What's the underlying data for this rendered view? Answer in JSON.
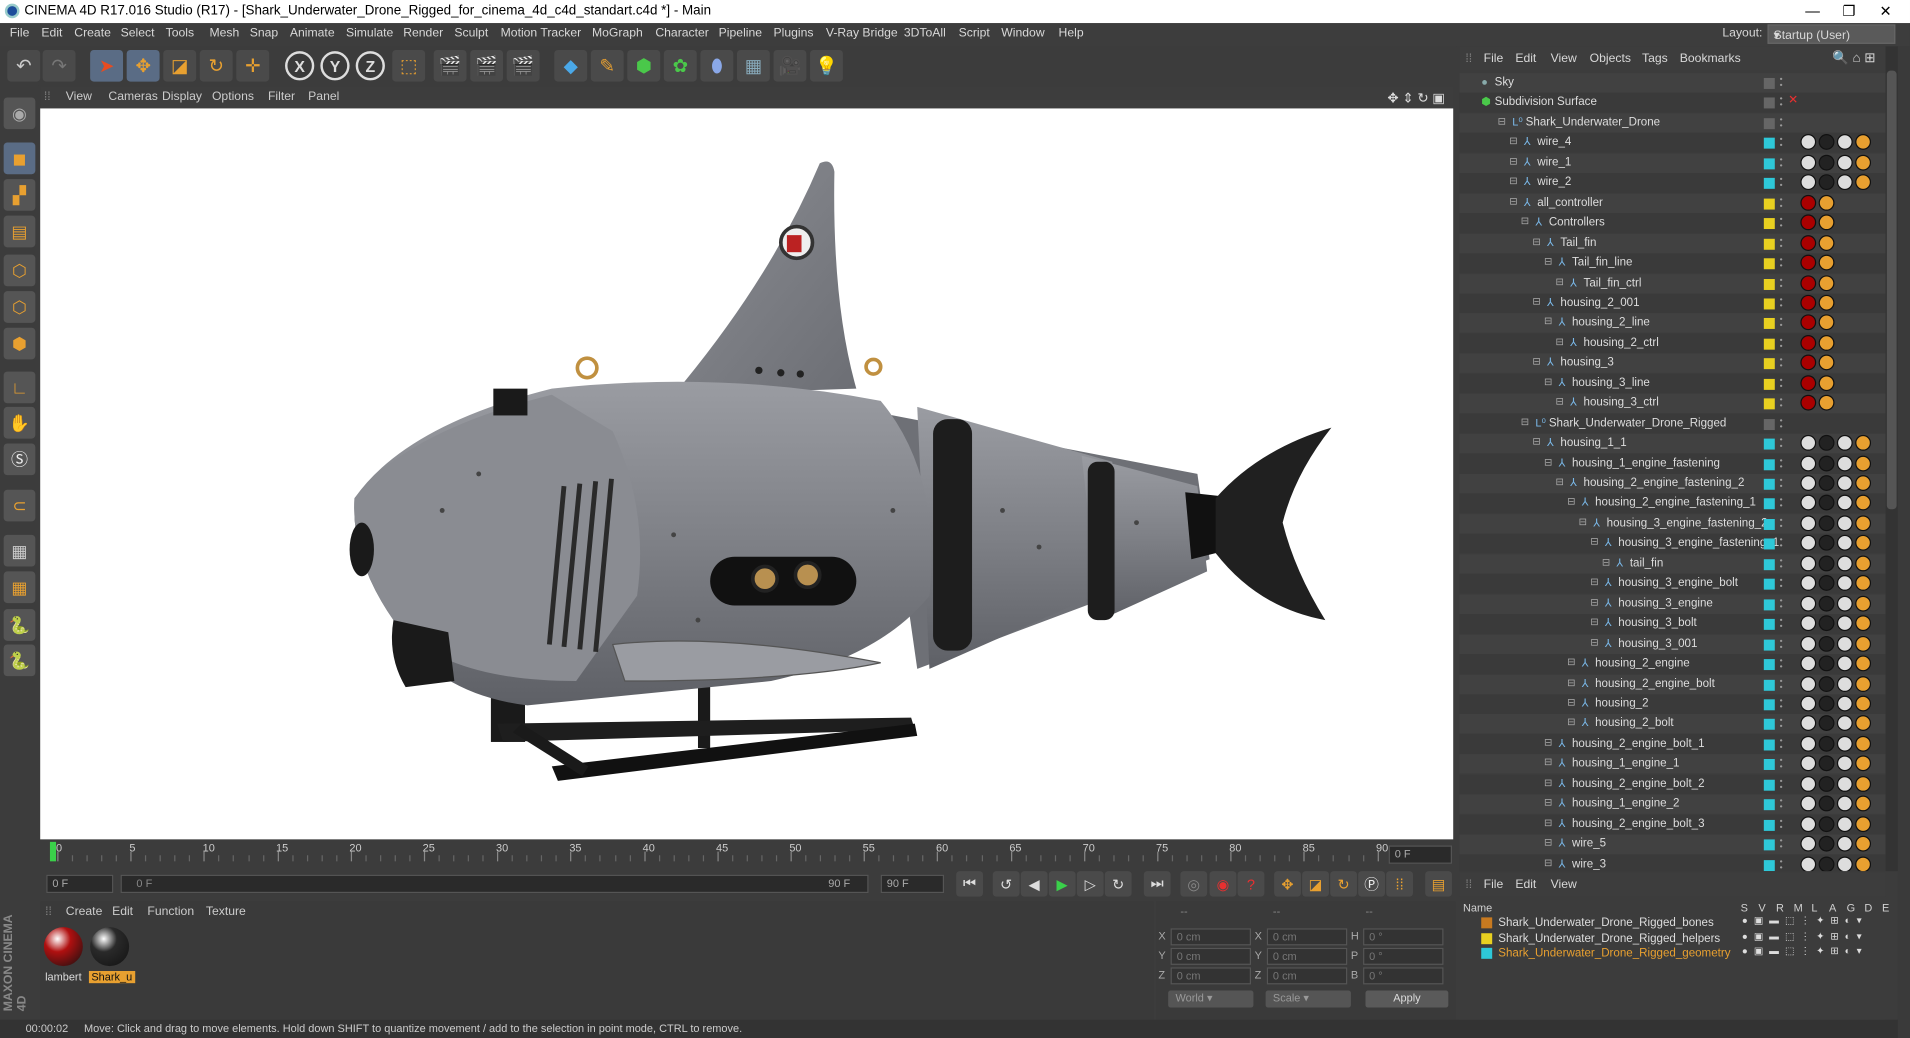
{
  "window": {
    "title": "CINEMA 4D R17.016 Studio (R17) - [Shark_Underwater_Drone_Rigged_for_cinema_4d_c4d_standart.c4d *] - Main",
    "controls": [
      "—",
      "❐",
      "✕"
    ]
  },
  "menubar": {
    "items": [
      "File",
      "Edit",
      "Create",
      "Select",
      "Tools",
      "Mesh",
      "Snap",
      "Animate",
      "Simulate",
      "Render",
      "Sculpt",
      "Motion Tracker",
      "MoGraph",
      "Character",
      "Pipeline",
      "Plugins",
      "V-Ray Bridge",
      "3DToAll",
      "Script",
      "Window",
      "Help"
    ],
    "layout_label": "Layout:",
    "layout_value": "Startup (User)"
  },
  "viewport": {
    "menu": [
      "View",
      "Cameras",
      "Display",
      "Options",
      "Filter",
      "Panel"
    ]
  },
  "timeline": {
    "ticks": [
      "0",
      "5",
      "10",
      "15",
      "20",
      "25",
      "30",
      "35",
      "40",
      "45",
      "50",
      "55",
      "60",
      "65",
      "70",
      "75",
      "80",
      "85",
      "90"
    ],
    "current_frame_field": "0 F"
  },
  "transport": {
    "start_field": "0 F",
    "slider_start": "0 F",
    "slider_end": "90 F",
    "end_field": "90 F"
  },
  "material_panel": {
    "menu": [
      "Create",
      "Edit",
      "Function",
      "Texture"
    ],
    "materials": [
      {
        "name": "lambert",
        "color": "#b01010"
      },
      {
        "name": "Shark_u",
        "color": "#2a2a2a"
      }
    ]
  },
  "coords": {
    "headers": [
      "--",
      "--",
      "--"
    ],
    "rows": [
      {
        "a": "X",
        "av": "0 cm",
        "b": "X",
        "bv": "0 cm",
        "c": "H",
        "cv": "0 °"
      },
      {
        "a": "Y",
        "av": "0 cm",
        "b": "Y",
        "bv": "0 cm",
        "c": "P",
        "cv": "0 °"
      },
      {
        "a": "Z",
        "av": "0 cm",
        "b": "Z",
        "bv": "0 cm",
        "c": "B",
        "cv": "0 °"
      }
    ],
    "mode1": "World",
    "mode2": "Scale",
    "apply": "Apply"
  },
  "status": {
    "time": "00:00:02",
    "message": "Move: Click and drag to move elements. Hold down SHIFT to quantize movement / add to the selection in point mode, CTRL to remove."
  },
  "object_manager": {
    "menu": [
      "File",
      "Edit",
      "View",
      "Objects",
      "Tags",
      "Bookmarks"
    ],
    "objects": [
      {
        "name": "Sky",
        "indent": 0,
        "layer": "",
        "kind": "sky"
      },
      {
        "name": "Subdivision Surface",
        "indent": 0,
        "layer": "",
        "kind": "subd"
      },
      {
        "name": "Shark_Underwater_Drone",
        "indent": 1,
        "layer": "",
        "kind": "null"
      },
      {
        "name": "wire_4",
        "indent": 2,
        "layer": "#2ec8d8",
        "kind": "bone"
      },
      {
        "name": "wire_1",
        "indent": 2,
        "layer": "#2ec8d8",
        "kind": "bone"
      },
      {
        "name": "wire_2",
        "indent": 2,
        "layer": "#2ec8d8",
        "kind": "bone"
      },
      {
        "name": "all_controller",
        "indent": 2,
        "layer": "#e8d020",
        "kind": "bone"
      },
      {
        "name": "Controllers",
        "indent": 3,
        "layer": "#e8d020",
        "kind": "bone"
      },
      {
        "name": "Tail_fin",
        "indent": 4,
        "layer": "#e8d020",
        "kind": "bone"
      },
      {
        "name": "Tail_fin_line",
        "indent": 5,
        "layer": "#e8d020",
        "kind": "bone"
      },
      {
        "name": "Tail_fin_ctrl",
        "indent": 6,
        "layer": "#e8d020",
        "kind": "bone"
      },
      {
        "name": "housing_2_001",
        "indent": 4,
        "layer": "#e8d020",
        "kind": "bone"
      },
      {
        "name": "housing_2_line",
        "indent": 5,
        "layer": "#e8d020",
        "kind": "bone"
      },
      {
        "name": "housing_2_ctrl",
        "indent": 6,
        "layer": "#e8d020",
        "kind": "bone"
      },
      {
        "name": "housing_3",
        "indent": 4,
        "layer": "#e8d020",
        "kind": "bone"
      },
      {
        "name": "housing_3_line",
        "indent": 5,
        "layer": "#e8d020",
        "kind": "bone"
      },
      {
        "name": "housing_3_ctrl",
        "indent": 6,
        "layer": "#e8d020",
        "kind": "bone"
      },
      {
        "name": "Shark_Underwater_Drone_Rigged",
        "indent": 3,
        "layer": "",
        "kind": "null"
      },
      {
        "name": "housing_1_1",
        "indent": 4,
        "layer": "#2ec8d8",
        "kind": "bone"
      },
      {
        "name": "housing_1_engine_fastening",
        "indent": 5,
        "layer": "#2ec8d8",
        "kind": "bone"
      },
      {
        "name": "housing_2_engine_fastening_2",
        "indent": 6,
        "layer": "#2ec8d8",
        "kind": "bone"
      },
      {
        "name": "housing_2_engine_fastening_1",
        "indent": 7,
        "layer": "#2ec8d8",
        "kind": "bone"
      },
      {
        "name": "housing_3_engine_fastening_2",
        "indent": 8,
        "layer": "#2ec8d8",
        "kind": "bone"
      },
      {
        "name": "housing_3_engine_fastening_1",
        "indent": 9,
        "layer": "#2ec8d8",
        "kind": "bone"
      },
      {
        "name": "tail_fin",
        "indent": 10,
        "layer": "#2ec8d8",
        "kind": "bone"
      },
      {
        "name": "housing_3_engine_bolt",
        "indent": 9,
        "layer": "#2ec8d8",
        "kind": "bone"
      },
      {
        "name": "housing_3_engine",
        "indent": 9,
        "layer": "#2ec8d8",
        "kind": "bone"
      },
      {
        "name": "housing_3_bolt",
        "indent": 9,
        "layer": "#2ec8d8",
        "kind": "bone"
      },
      {
        "name": "housing_3_001",
        "indent": 9,
        "layer": "#2ec8d8",
        "kind": "bone"
      },
      {
        "name": "housing_2_engine",
        "indent": 7,
        "layer": "#2ec8d8",
        "kind": "bone"
      },
      {
        "name": "housing_2_engine_bolt",
        "indent": 7,
        "layer": "#2ec8d8",
        "kind": "bone"
      },
      {
        "name": "housing_2",
        "indent": 7,
        "layer": "#2ec8d8",
        "kind": "bone"
      },
      {
        "name": "housing_2_bolt",
        "indent": 7,
        "layer": "#2ec8d8",
        "kind": "bone"
      },
      {
        "name": "housing_2_engine_bolt_1",
        "indent": 5,
        "layer": "#2ec8d8",
        "kind": "bone"
      },
      {
        "name": "housing_1_engine_1",
        "indent": 5,
        "layer": "#2ec8d8",
        "kind": "bone"
      },
      {
        "name": "housing_2_engine_bolt_2",
        "indent": 5,
        "layer": "#2ec8d8",
        "kind": "bone"
      },
      {
        "name": "housing_1_engine_2",
        "indent": 5,
        "layer": "#2ec8d8",
        "kind": "bone"
      },
      {
        "name": "housing_2_engine_bolt_3",
        "indent": 5,
        "layer": "#2ec8d8",
        "kind": "bone"
      },
      {
        "name": "wire_5",
        "indent": 5,
        "layer": "#2ec8d8",
        "kind": "bone"
      },
      {
        "name": "wire_3",
        "indent": 5,
        "layer": "#2ec8d8",
        "kind": "bone"
      }
    ]
  },
  "layer_manager": {
    "menu": [
      "File",
      "Edit",
      "View"
    ],
    "header_name": "Name",
    "header_cols": [
      "S",
      "V",
      "R",
      "M",
      "L",
      "A",
      "G",
      "D",
      "E"
    ],
    "layers": [
      {
        "name": "Shark_Underwater_Drone_Rigged_bones",
        "color": "#c87a20",
        "active": false
      },
      {
        "name": "Shark_Underwater_Drone_Rigged_helpers",
        "color": "#e8d020",
        "active": false
      },
      {
        "name": "Shark_Underwater_Drone_Rigged_geometry",
        "color": "#2ec8d8",
        "active": true
      }
    ]
  },
  "brand": {
    "vertical": "MAXON CINEMA 4D"
  },
  "colors": {
    "accent_orange": "#e8a030",
    "selection_blue": "#5a6c85",
    "viewport_bg": "#ffffff"
  }
}
